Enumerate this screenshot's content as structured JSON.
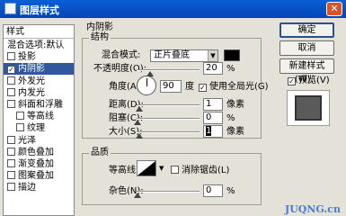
{
  "window": {
    "title": "图层样式",
    "close_glyph": "✕"
  },
  "left_panel": {
    "header": "样式",
    "items": [
      {
        "label": "混合选项:默认",
        "checkbox": false,
        "checked": false,
        "selected": false,
        "indent": false
      },
      {
        "label": "投影",
        "checkbox": true,
        "checked": false,
        "selected": false,
        "indent": false
      },
      {
        "label": "内阴影",
        "checkbox": true,
        "checked": true,
        "selected": true,
        "indent": false
      },
      {
        "label": "外发光",
        "checkbox": true,
        "checked": false,
        "selected": false,
        "indent": false
      },
      {
        "label": "内发光",
        "checkbox": true,
        "checked": false,
        "selected": false,
        "indent": false
      },
      {
        "label": "斜面和浮雕",
        "checkbox": true,
        "checked": false,
        "selected": false,
        "indent": false
      },
      {
        "label": "等高线",
        "checkbox": true,
        "checked": false,
        "selected": false,
        "indent": true
      },
      {
        "label": "纹理",
        "checkbox": true,
        "checked": false,
        "selected": false,
        "indent": true
      },
      {
        "label": "光泽",
        "checkbox": true,
        "checked": false,
        "selected": false,
        "indent": false
      },
      {
        "label": "颜色叠加",
        "checkbox": true,
        "checked": false,
        "selected": false,
        "indent": false
      },
      {
        "label": "渐变叠加",
        "checkbox": true,
        "checked": false,
        "selected": false,
        "indent": false
      },
      {
        "label": "图案叠加",
        "checkbox": true,
        "checked": false,
        "selected": false,
        "indent": false
      },
      {
        "label": "描边",
        "checkbox": true,
        "checked": false,
        "selected": false,
        "indent": false
      }
    ]
  },
  "inner_shadow": {
    "section_title": "内阴影",
    "structure": {
      "title": "结构",
      "blend_mode_label": "混合模式:",
      "blend_mode_value": "正片叠底",
      "shadow_color": "#000000",
      "opacity_label": "不透明度(O):",
      "opacity_value": "20",
      "opacity_unit": "%",
      "angle_label": "角度(A):",
      "angle_value": "90",
      "angle_unit": "度",
      "global_light_label": "使用全局光(G)",
      "global_light_checked": true,
      "distance_label": "距离(D):",
      "distance_value": "1",
      "distance_unit": "像素",
      "choke_label": "阻塞(C):",
      "choke_value": "0",
      "choke_unit": "%",
      "size_label": "大小(S):",
      "size_value": "1",
      "size_unit": "像素"
    },
    "quality": {
      "title": "品质",
      "contour_label": "等高线:",
      "anti_alias_label": "消除锯齿(L)",
      "anti_alias_checked": false,
      "noise_label": "杂色(N):",
      "noise_value": "0",
      "noise_unit": "%"
    }
  },
  "buttons": {
    "ok": "确定",
    "cancel": "取消",
    "new_style": "新建样式(W)...",
    "preview_label": "预览(V)",
    "preview_checked": true
  },
  "watermark": "JUQNG.cn",
  "check_glyph": "✓"
}
